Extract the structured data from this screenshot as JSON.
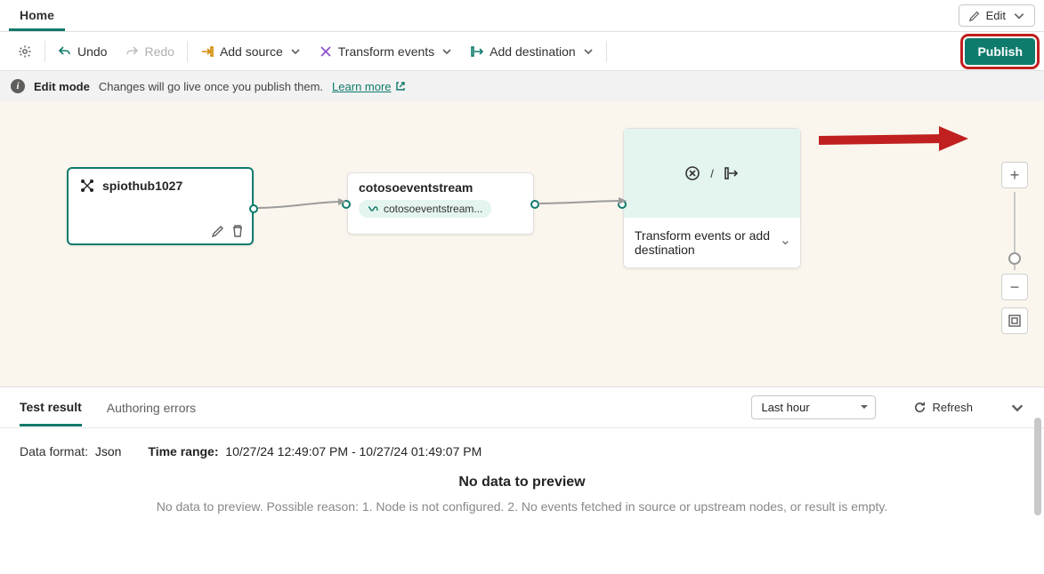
{
  "topbar": {
    "tab": "Home",
    "edit": "Edit"
  },
  "toolbar": {
    "undo": "Undo",
    "redo": "Redo",
    "add_source": "Add source",
    "transform": "Transform events",
    "add_dest": "Add destination",
    "publish": "Publish"
  },
  "infobar": {
    "mode": "Edit mode",
    "msg": "Changes will go live once you publish them.",
    "learn": "Learn more"
  },
  "nodes": {
    "source": {
      "title": "spiothub1027"
    },
    "stream": {
      "title": "cotosoeventstream",
      "pill": "cotosoeventstream..."
    },
    "dest": {
      "label": "Transform events or add destination"
    }
  },
  "panel": {
    "tabs": {
      "test": "Test result",
      "errors": "Authoring errors"
    },
    "time_select": "Last hour",
    "refresh": "Refresh",
    "data_format_lbl": "Data format:",
    "data_format_val": "Json",
    "time_range_lbl": "Time range:",
    "time_range_val": "10/27/24 12:49:07 PM - 10/27/24 01:49:07 PM",
    "no_data_title": "No data to preview",
    "no_data_msg": "No data to preview. Possible reason: 1. Node is not configured. 2. No events fetched in source or upstream nodes, or result is empty."
  }
}
